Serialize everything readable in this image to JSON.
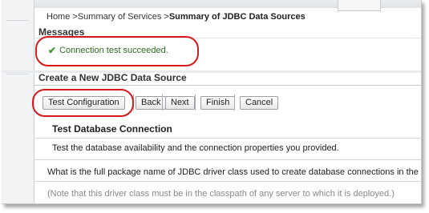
{
  "breadcrumb": {
    "home": "Home",
    "sep": " >",
    "summary_services": "Summary of Services",
    "current": "Summary of JDBC Data Sources"
  },
  "messages": {
    "title": "Messages",
    "success_text": "Connection test succeeded."
  },
  "panel": {
    "title": "Create a New JDBC Data Source"
  },
  "buttons": {
    "test_configuration": "Test Configuration",
    "back": "Back",
    "next": "Next",
    "finish": "Finish",
    "cancel": "Cancel"
  },
  "section": {
    "title": "Test Database Connection",
    "description": "Test the database availability and the connection properties you provided.",
    "question": "What is the full package name of JDBC driver class used to create database connections in the co",
    "note": "(Note that this driver class must be in the classpath of any server to which it is deployed.)"
  },
  "icons": {
    "success": "check-icon"
  },
  "colors": {
    "annotation_red": "#d81a1a",
    "success_green": "#2b6d1f"
  }
}
